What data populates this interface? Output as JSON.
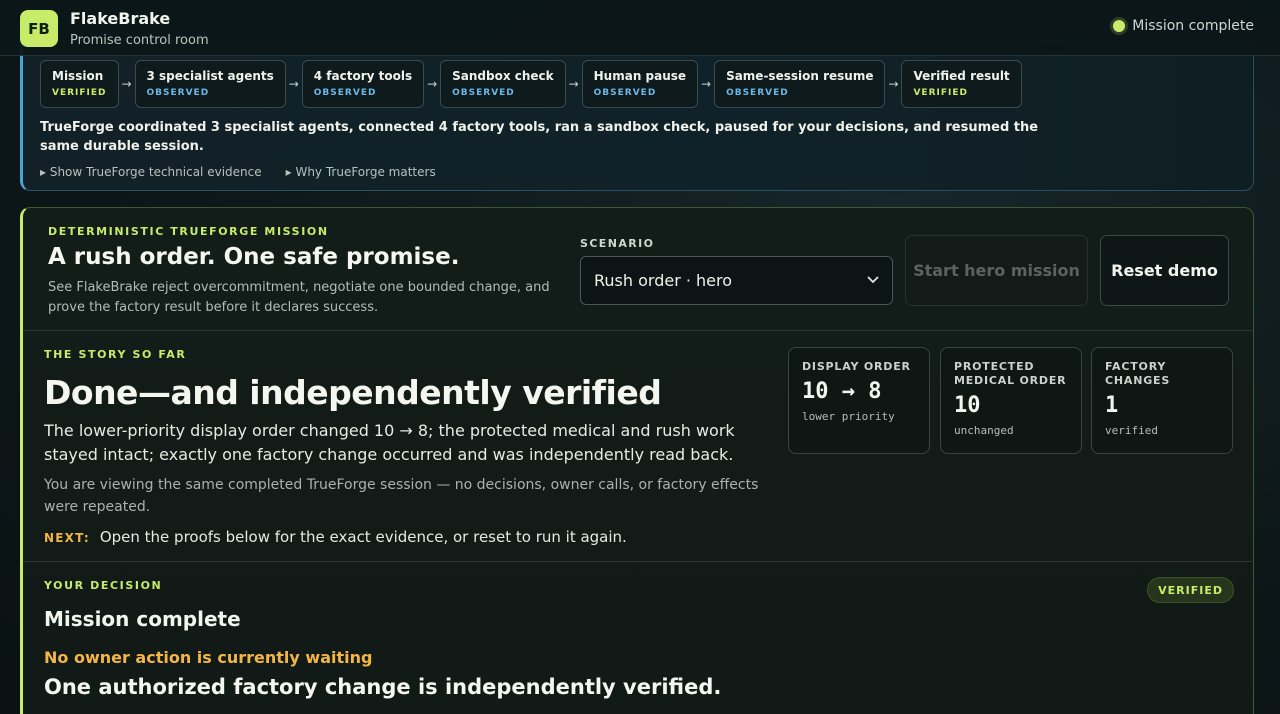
{
  "app": {
    "logo": "FB",
    "name": "FlakeBrake",
    "subtitle": "Promise control room",
    "status": "Mission complete"
  },
  "harness": {
    "steps": [
      {
        "title": "Mission",
        "status": "VERIFIED"
      },
      {
        "title": "3 specialist agents",
        "status": "OBSERVED"
      },
      {
        "title": "4 factory tools",
        "status": "OBSERVED"
      },
      {
        "title": "Sandbox check",
        "status": "OBSERVED"
      },
      {
        "title": "Human pause",
        "status": "OBSERVED"
      },
      {
        "title": "Same-session resume",
        "status": "OBSERVED"
      },
      {
        "title": "Verified result",
        "status": "VERIFIED"
      }
    ],
    "arrow": "→",
    "summary": "TrueForge coordinated 3 specialist agents, connected 4 factory tools, ran a sandbox check, paused for your decisions, and resumed the same durable session.",
    "link_evidence": "▸ Show TrueForge technical evidence",
    "link_why": "▸ Why TrueForge matters"
  },
  "mission": {
    "eyebrow": "DETERMINISTIC TRUEFORGE MISSION",
    "title": "A rush order. One safe promise.",
    "description": "See FlakeBrake reject overcommitment, negotiate one bounded change, and prove the factory result before it declares success.",
    "scenario_label": "SCENARIO",
    "scenario_value": "Rush order · hero",
    "start_label": "Start hero mission",
    "reset_label": "Reset demo"
  },
  "story": {
    "eyebrow": "THE STORY SO FAR",
    "title": "Done—and independently verified",
    "body": "The lower-priority display order changed 10 → 8; the protected medical and rush work stayed intact; exactly one factory change occurred and was independently read back.",
    "note": "You are viewing the same completed TrueForge session — no decisions, owner calls, or factory effects were repeated.",
    "next_label": "NEXT:",
    "next_text": "Open the proofs below for the exact evidence, or reset to run it again.",
    "stats": [
      {
        "label": "DISPLAY ORDER",
        "value": "10 → 8",
        "caption": "lower priority"
      },
      {
        "label": "PROTECTED MEDICAL ORDER",
        "value": "10",
        "caption": "unchanged"
      },
      {
        "label": "FACTORY CHANGES",
        "value": "1",
        "caption": "verified"
      }
    ]
  },
  "decision": {
    "eyebrow": "YOUR DECISION",
    "badge": "VERIFIED",
    "title": "Mission complete",
    "waiting": "No owner action is currently waiting",
    "result": "One authorized factory change is independently verified."
  }
}
